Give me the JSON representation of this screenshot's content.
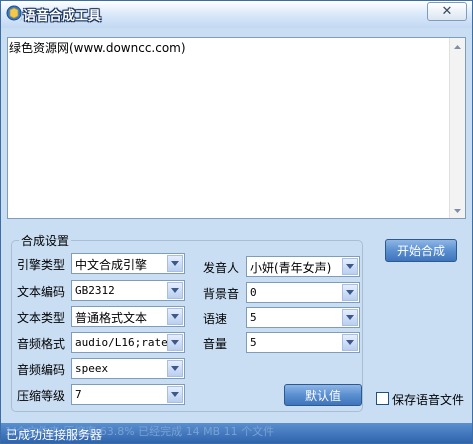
{
  "window": {
    "title": "语音合成工具",
    "title_ghost": "选项 删除",
    "close_symbol": "✕"
  },
  "editor": {
    "text": "绿色资源网(www.downcc.com)"
  },
  "settings": {
    "group_title": "合成设置",
    "engine_label": "引擎类型",
    "engine_value": "中文合成引擎",
    "encoding_label": "文本编码",
    "encoding_value": "GB2312",
    "text_type_label": "文本类型",
    "text_type_value": "普通格式文本",
    "audio_format_label": "音频格式",
    "audio_format_value": "audio/L16;rate=",
    "audio_codec_label": "音频编码",
    "audio_codec_value": "speex",
    "compress_label": "压缩等级",
    "compress_value": "7",
    "speaker_label": "发音人",
    "speaker_value": "小妍(青年女声)",
    "bgm_label": "背景音",
    "bgm_value": "0",
    "speed_label": "语速",
    "speed_value": "5",
    "volume_label": "音量",
    "volume_value": "5",
    "default_button": "默认值"
  },
  "actions": {
    "start_button": "开始合成",
    "save_audio_label": "保存语音文件",
    "save_audio_checked": false
  },
  "status": {
    "text": "已成功连接服务器",
    "ghost": "1/个文件夹 压缩率 63.8% 已经完成 14 MB 11 个文件"
  },
  "colors": {
    "window_bg": "#c9ddf3",
    "button_blue": "#4f86cb",
    "status_blue": "#3a6fb8"
  },
  "icons": [
    "app-icon",
    "close-icon",
    "dropdown-arrow-icon",
    "scroll-up-icon",
    "scroll-down-icon"
  ]
}
